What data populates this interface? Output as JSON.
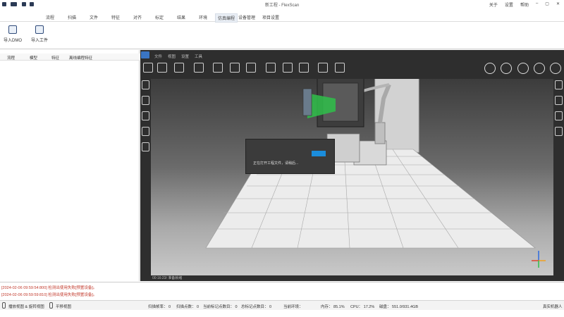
{
  "app": {
    "title": "新工程 - FlexScan"
  },
  "quick_access": [
    "new-file-icon",
    "open-folder-icon",
    "save-icon",
    "save-as-icon"
  ],
  "window_controls": {
    "about": "关于",
    "settings": "设置",
    "help": "帮助",
    "minimize": "–",
    "maximize": "▢",
    "close": "✕"
  },
  "tabs": [
    "流程",
    "扫描",
    "文件",
    "特征",
    "对齐",
    "标定",
    "结果",
    "环境",
    "仿真编程",
    "设备管理",
    "项目设置"
  ],
  "active_tab": "仿真编程",
  "ribbon": [
    {
      "label": "导入DMO",
      "icon": "import-dmo-icon"
    },
    {
      "label": "导入工件",
      "icon": "import-workpiece-icon"
    }
  ],
  "left_panel": {
    "columns": [
      "流程",
      "模型",
      "特征",
      "离线编程特征"
    ]
  },
  "viewer": {
    "menu": [
      "文件",
      "视图",
      "设置",
      "工具"
    ],
    "dialog_message": "正在打开工程文件，请稍后...",
    "status_text": "00:16:23/  准备就绪",
    "colors": {
      "toolbar_bg": "#2e2e2e",
      "progress": "#1b8ddc",
      "scan_cone": "#2fbf4a"
    }
  },
  "console": {
    "lines": [
      "[2024-02-06 09:59:54:800] 检测出使用失败[预置设备]。",
      "[2024-02-06 09:59:59:810] 检测出使用失败[预置设备]。"
    ]
  },
  "statusbar": {
    "view_mode_1": "播放视图 & 旋转视图",
    "view_mode_2": "平移视图",
    "scan_freq": "扫描帧率：  0",
    "scan_points": "扫描点数：  0",
    "cur_markers": "当前标记点数目：  0",
    "total_markers": "总标记点数目：  0",
    "env": "当前环境：",
    "memory": "内存：  85.1%",
    "cpu": "CPU：  17.2%",
    "disk": "磁盘：  551.0/931.4GB",
    "right": "真实机器人"
  }
}
